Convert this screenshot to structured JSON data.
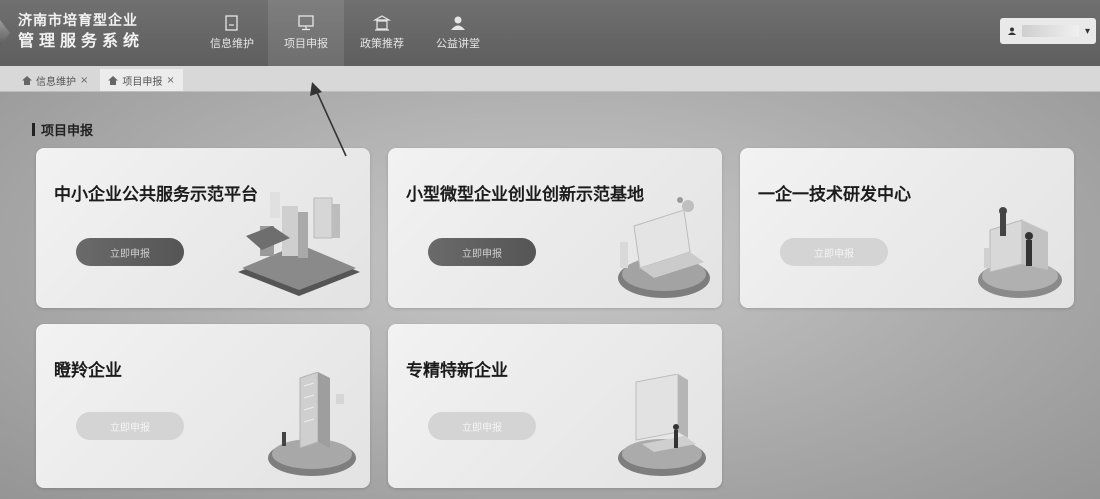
{
  "header": {
    "brand_line1": "济南市培育型企业",
    "brand_line2": "管理服务系统",
    "nav": [
      {
        "label": "信息维护",
        "icon": "document-icon"
      },
      {
        "label": "项目申报",
        "icon": "monitor-icon"
      },
      {
        "label": "政策推荐",
        "icon": "building-icon"
      },
      {
        "label": "公益讲堂",
        "icon": "person-icon"
      }
    ],
    "active_nav": "项目申报",
    "user_caret": "▾"
  },
  "tabs": [
    {
      "label": "信息维护",
      "close": "×"
    },
    {
      "label": "项目申报",
      "close": "×"
    }
  ],
  "section": {
    "title": "项目申报"
  },
  "cards": [
    {
      "title": "中小企业公共服务示范平台",
      "button": "立即申报",
      "button_state": "enabled",
      "illustration": "city-platform-illustration"
    },
    {
      "title": "小型微型企业创业创新示范基地",
      "button": "立即申报",
      "button_state": "enabled",
      "illustration": "laptop-illustration"
    },
    {
      "title": "一企一技术研发中心",
      "button": "立即申报",
      "button_state": "disabled",
      "illustration": "research-people-illustration"
    },
    {
      "title": "瞪羚企业",
      "button": "立即申报",
      "button_state": "disabled",
      "illustration": "tower-illustration"
    },
    {
      "title": "专精特新企业",
      "button": "立即申报",
      "button_state": "disabled",
      "illustration": "screen-illustration"
    }
  ],
  "colors": {
    "header_bg": "#666666",
    "content_bg": "#b5b5b5",
    "card_bg": "#eeeeee",
    "button_enabled": "#606060",
    "button_disabled": "#d4d4d4"
  }
}
